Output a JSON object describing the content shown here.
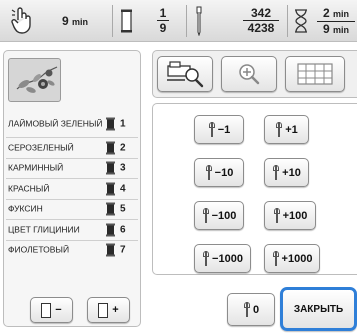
{
  "status_bar": {
    "time_value": "9",
    "time_unit": "min",
    "color_current": "1",
    "color_total": "9",
    "stitch_current": "342",
    "stitch_total": "4238",
    "time_remaining": "2",
    "time_total": "9",
    "time_remaining_unit": "min",
    "time_total_unit": "min"
  },
  "thread_colors": [
    {
      "name": "ЛАЙМОВЫЙ ЗЕЛЕНЫЙ",
      "index": "1"
    },
    {
      "name": "СЕРОЗЕЛЕНЫЙ",
      "index": "2"
    },
    {
      "name": "КАРМИННЫЙ",
      "index": "3"
    },
    {
      "name": "КРАСНЫЙ",
      "index": "4"
    },
    {
      "name": "ФУКСИН",
      "index": "5"
    },
    {
      "name": "ЦВЕТ ГЛИЦИНИИ",
      "index": "6"
    },
    {
      "name": "ФИОЛЕТОВЫЙ",
      "index": "7"
    }
  ],
  "color_nav": {
    "prev_label": "−",
    "next_label": "+"
  },
  "stitch_buttons": {
    "minus1": "−1",
    "plus1": "+1",
    "minus10": "−10",
    "plus10": "+10",
    "minus100": "−100",
    "plus100": "+100",
    "minus1000": "−1000",
    "plus1000": "+1000",
    "zero": "0"
  },
  "close_label": "ЗАКРЫТЬ",
  "colors": {
    "accent": "#2f7fd8",
    "spool": "#2a2a2a"
  }
}
